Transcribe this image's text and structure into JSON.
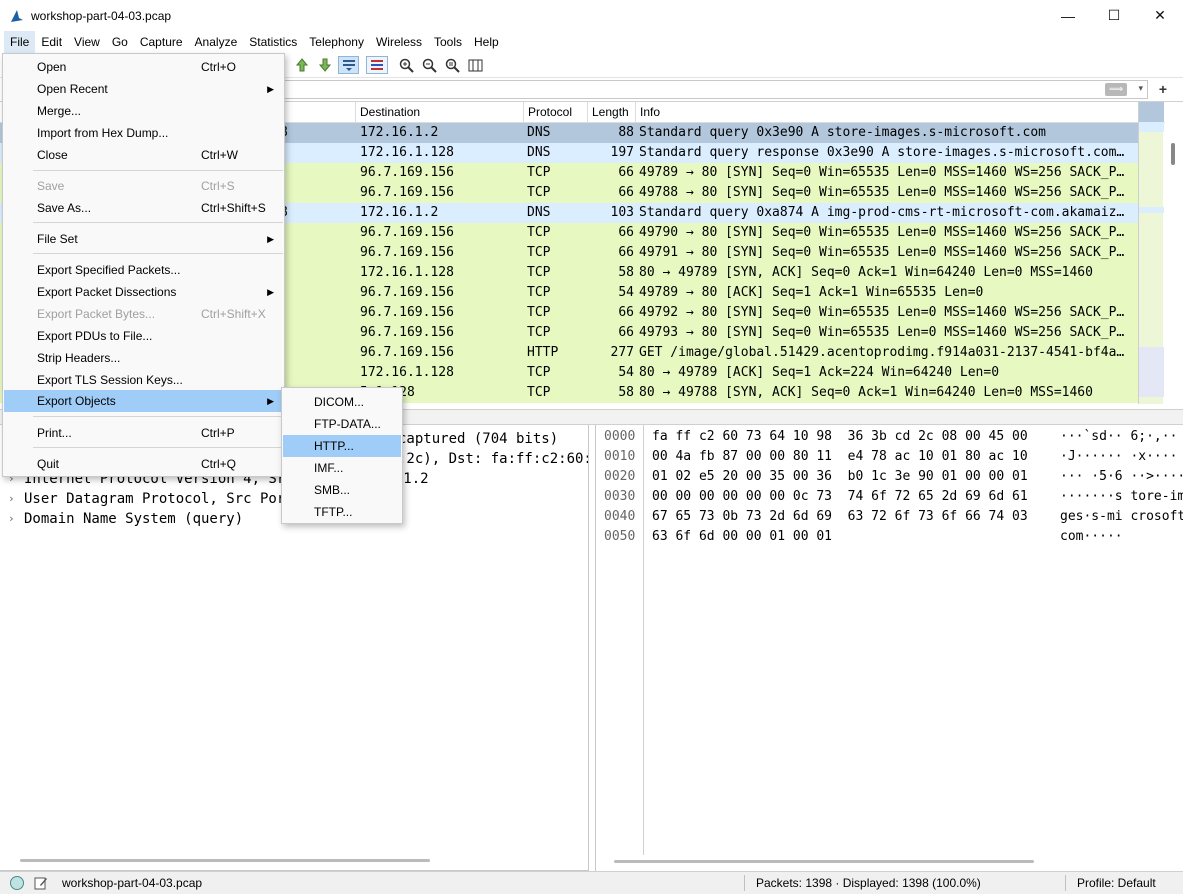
{
  "window": {
    "title": "workshop-part-04-03.pcap",
    "minimize": "—",
    "maximize": "☐",
    "close": "✕"
  },
  "menubar": [
    "File",
    "Edit",
    "View",
    "Go",
    "Capture",
    "Analyze",
    "Statistics",
    "Telephony",
    "Wireless",
    "Tools",
    "Help"
  ],
  "packet_list": {
    "columns": [
      "Destination",
      "Protocol",
      "Length",
      "Info"
    ],
    "rows": [
      {
        "src_tail": "8",
        "dst": "172.16.1.2",
        "proto": "DNS",
        "len": "88",
        "info": "Standard query 0x3e90 A store-images.s-microsoft.com",
        "bg": "#b3c7dc"
      },
      {
        "src_tail": "",
        "dst": "172.16.1.128",
        "proto": "DNS",
        "len": "197",
        "info": "Standard query response 0x3e90 A store-images.s-microsoft.com…",
        "bg": "#daeeff"
      },
      {
        "src_tail": "",
        "dst": "96.7.169.156",
        "proto": "TCP",
        "len": "66",
        "info": "49789 → 80 [SYN] Seq=0 Win=65535 Len=0 MSS=1460 WS=256 SACK_P…",
        "bg": "#e7f9c0"
      },
      {
        "src_tail": "",
        "dst": "96.7.169.156",
        "proto": "TCP",
        "len": "66",
        "info": "49788 → 80 [SYN] Seq=0 Win=65535 Len=0 MSS=1460 WS=256 SACK_P…",
        "bg": "#e7f9c0"
      },
      {
        "src_tail": "8",
        "dst": "172.16.1.2",
        "proto": "DNS",
        "len": "103",
        "info": "Standard query 0xa874 A img-prod-cms-rt-microsoft-com.akamaiz…",
        "bg": "#daeeff"
      },
      {
        "src_tail": "",
        "dst": "96.7.169.156",
        "proto": "TCP",
        "len": "66",
        "info": "49790 → 80 [SYN] Seq=0 Win=65535 Len=0 MSS=1460 WS=256 SACK_P…",
        "bg": "#e7f9c0"
      },
      {
        "src_tail": "",
        "dst": "96.7.169.156",
        "proto": "TCP",
        "len": "66",
        "info": "49791 → 80 [SYN] Seq=0 Win=65535 Len=0 MSS=1460 WS=256 SACK_P…",
        "bg": "#e7f9c0"
      },
      {
        "src_tail": "",
        "dst": "172.16.1.128",
        "proto": "TCP",
        "len": "58",
        "info": "80 → 49789 [SYN, ACK] Seq=0 Ack=1 Win=64240 Len=0 MSS=1460",
        "bg": "#e7f9c0"
      },
      {
        "src_tail": "",
        "dst": "96.7.169.156",
        "proto": "TCP",
        "len": "54",
        "info": "49789 → 80 [ACK] Seq=1 Ack=1 Win=65535 Len=0",
        "bg": "#e7f9c0"
      },
      {
        "src_tail": "",
        "dst": "96.7.169.156",
        "proto": "TCP",
        "len": "66",
        "info": "49792 → 80 [SYN] Seq=0 Win=65535 Len=0 MSS=1460 WS=256 SACK_P…",
        "bg": "#e7f9c0"
      },
      {
        "src_tail": "",
        "dst": "96.7.169.156",
        "proto": "TCP",
        "len": "66",
        "info": "49793 → 80 [SYN] Seq=0 Win=65535 Len=0 MSS=1460 WS=256 SACK_P…",
        "bg": "#e7f9c0"
      },
      {
        "src_tail": "",
        "dst": "96.7.169.156",
        "proto": "HTTP",
        "len": "277",
        "info": "GET /image/global.51429.acentoprodimg.f914a031-2137-4541-bf4a…",
        "bg": "#e7f9c0"
      },
      {
        "src_tail": "",
        "dst": "172.16.1.128",
        "proto": "TCP",
        "len": "54",
        "info": "80 → 49789 [ACK] Seq=1 Ack=224 Win=64240 Len=0",
        "bg": "#e7f9c0"
      },
      {
        "src_tail": "",
        "dst": "5.1.128",
        "proto": "TCP",
        "len": "58",
        "info": "80 → 49788 [SYN, ACK] Seq=0 Ack=1 Win=64240 Len=0 MSS=1460",
        "bg": "#e7f9c0"
      }
    ]
  },
  "details": [
    {
      "arrow": "",
      "text": "captured (704 bits)"
    },
    {
      "arrow": "",
      "text": ":2c), Dst: fa:ff:c2:60:7"
    },
    {
      "arrow": "›",
      "text": "Internet Protocol Version 4, Src              Dst: 172.16.1.2"
    },
    {
      "arrow": "›",
      "text": "User Datagram Protocol, Src Port             rt: 53"
    },
    {
      "arrow": "›",
      "text": "Domain Name System (query)"
    }
  ],
  "bytes": [
    {
      "off": "0000",
      "hex": "fa ff c2 60 73 64 10 98  36 3b cd 2c 08 00 45 00",
      "ascii": "···`sd·· 6;·,··"
    },
    {
      "off": "0010",
      "hex": "00 4a fb 87 00 00 80 11  e4 78 ac 10 01 80 ac 10",
      "ascii": "·J······ ·x····"
    },
    {
      "off": "0020",
      "hex": "01 02 e5 20 00 35 00 36  b0 1c 3e 90 01 00 00 01",
      "ascii": "··· ·5·6 ··>····"
    },
    {
      "off": "0030",
      "hex": "00 00 00 00 00 00 0c 73  74 6f 72 65 2d 69 6d 61",
      "ascii": "·······s tore-im"
    },
    {
      "off": "0040",
      "hex": "67 65 73 0b 73 2d 6d 69  63 72 6f 73 6f 66 74 03",
      "ascii": "ges·s-mi crosoft·"
    },
    {
      "off": "0050",
      "hex": "63 6f 6d 00 00 01 00 01",
      "ascii": "com·····"
    }
  ],
  "statusbar": {
    "file": "workshop-part-04-03.pcap",
    "packets": "Packets: 1398 · Displayed: 1398 (100.0%)",
    "profile": "Profile: Default"
  },
  "file_menu": {
    "items": [
      {
        "label": "Open",
        "shortcut": "Ctrl+O",
        "sub": false,
        "disabled": false
      },
      {
        "label": "Open Recent",
        "shortcut": "",
        "sub": true,
        "disabled": false
      },
      {
        "label": "Merge...",
        "shortcut": "",
        "sub": false,
        "disabled": false
      },
      {
        "label": "Import from Hex Dump...",
        "shortcut": "",
        "sub": false,
        "disabled": false
      },
      {
        "label": "Close",
        "shortcut": "Ctrl+W",
        "sub": false,
        "disabled": false
      },
      {
        "label": "Save",
        "shortcut": "Ctrl+S",
        "sub": false,
        "disabled": true
      },
      {
        "label": "Save As...",
        "shortcut": "Ctrl+Shift+S",
        "sub": false,
        "disabled": false
      },
      {
        "label": "File Set",
        "shortcut": "",
        "sub": true,
        "disabled": false
      },
      {
        "label": "Export Specified Packets...",
        "shortcut": "",
        "sub": false,
        "disabled": false
      },
      {
        "label": "Export Packet Dissections",
        "shortcut": "",
        "sub": true,
        "disabled": false
      },
      {
        "label": "Export Packet Bytes...",
        "shortcut": "Ctrl+Shift+X",
        "sub": false,
        "disabled": true
      },
      {
        "label": "Export PDUs to File...",
        "shortcut": "",
        "sub": false,
        "disabled": false
      },
      {
        "label": "Strip Headers...",
        "shortcut": "",
        "sub": false,
        "disabled": false
      },
      {
        "label": "Export TLS Session Keys...",
        "shortcut": "",
        "sub": false,
        "disabled": false
      },
      {
        "label": "Export Objects",
        "shortcut": "",
        "sub": true,
        "disabled": false
      },
      {
        "label": "Print...",
        "shortcut": "Ctrl+P",
        "sub": false,
        "disabled": false
      },
      {
        "label": "Quit",
        "shortcut": "Ctrl+Q",
        "sub": false,
        "disabled": false
      }
    ]
  },
  "export_objects_menu": [
    "DICOM...",
    "FTP-DATA...",
    "HTTP...",
    "IMF...",
    "SMB...",
    "TFTP..."
  ],
  "colors": {
    "accent_highlight": "#9fcdf7",
    "tcp_row": "#e7f9c0",
    "dns_row": "#daeeff",
    "selected_row": "#b3c7dc"
  }
}
